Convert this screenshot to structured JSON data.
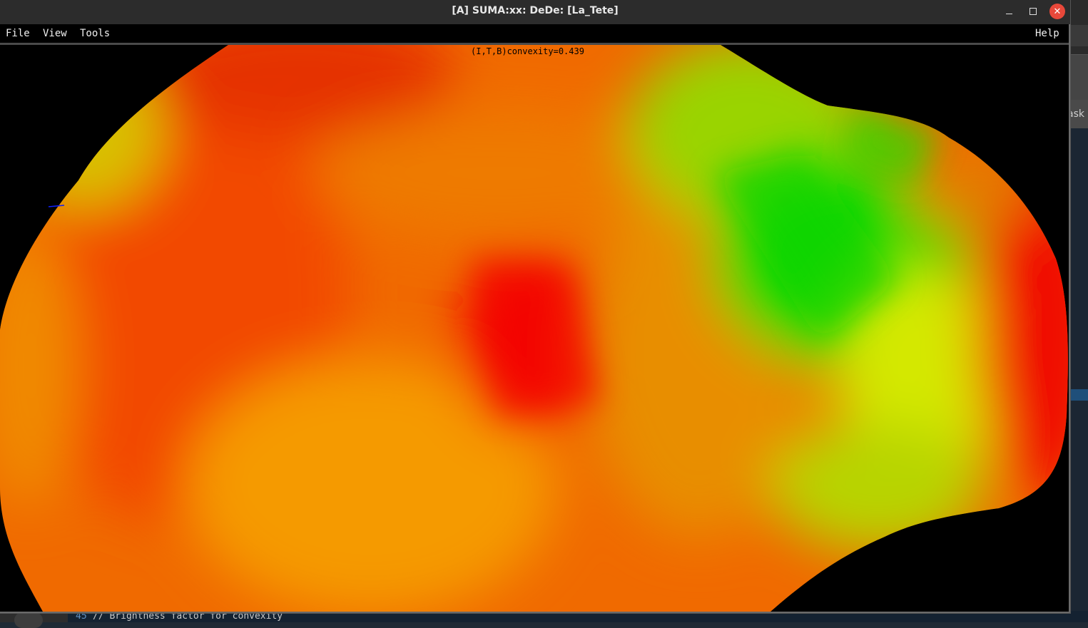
{
  "window": {
    "title": "[A] SUMA:xx: DeDe: [La_Tete]",
    "minimize_icon": "minimize-icon",
    "maximize_icon": "maximize-icon",
    "close_icon": "close-icon",
    "close_color": "#e8483a"
  },
  "menubar": {
    "file": "File",
    "view": "View",
    "tools": "Tools",
    "help": "Help"
  },
  "viewport": {
    "overlay_text": "(I,T,B)convexity=0.439",
    "colors": {
      "background": "#000000",
      "red": "#ee1100",
      "orange": "#f26b00",
      "amber": "#f5a000",
      "yellow": "#d8e800",
      "green": "#10d800"
    }
  },
  "background_app": {
    "right_tab_text": "ask",
    "editor_line_number": "45",
    "editor_line_text": "//     Brightness factor for convexity"
  }
}
